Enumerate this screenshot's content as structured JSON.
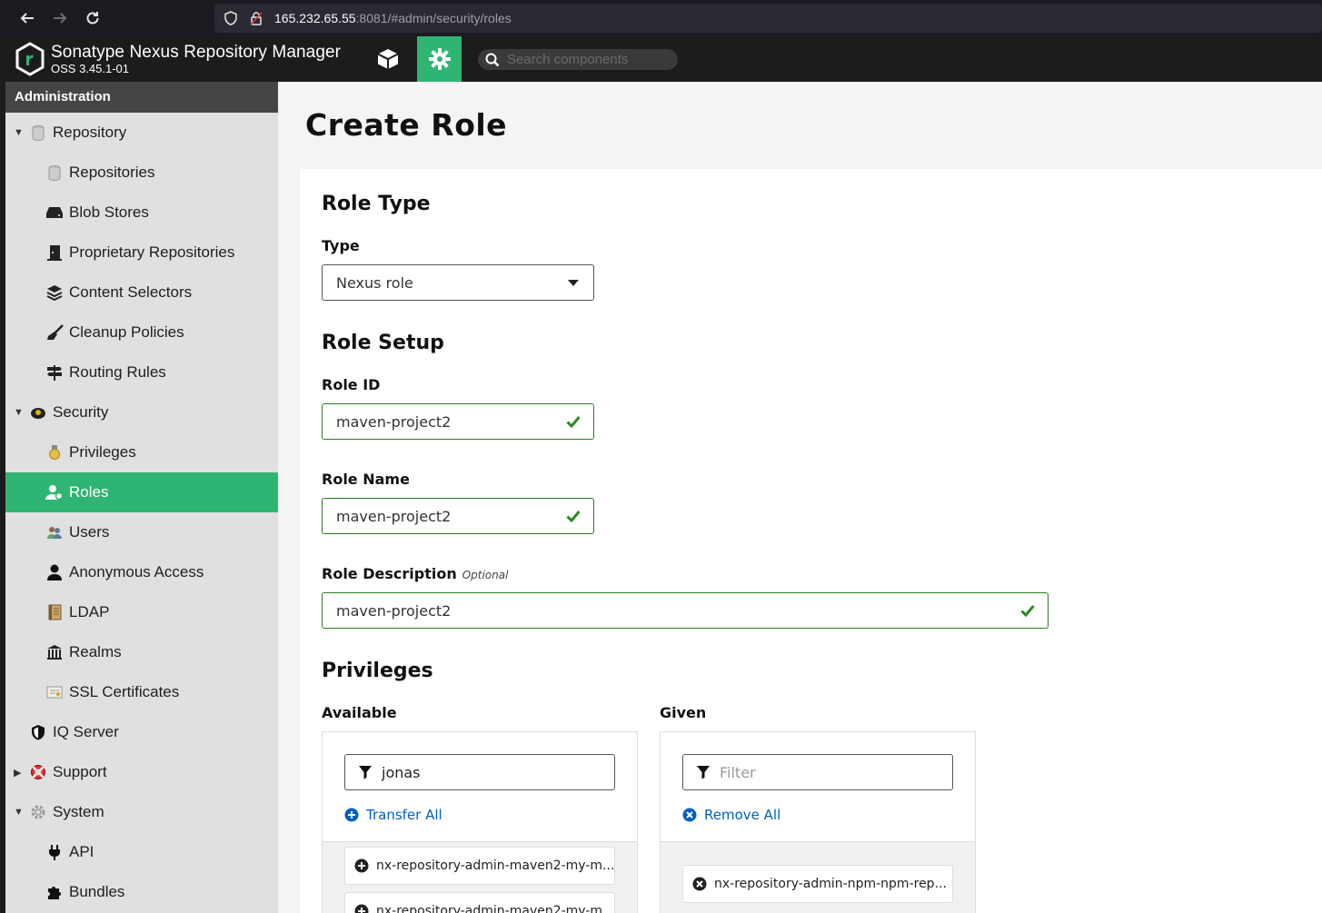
{
  "browser": {
    "url_host": "165.232.65.55",
    "url_path": ":8081/#admin/security/roles"
  },
  "header": {
    "app_title": "Sonatype Nexus Repository Manager",
    "version": "OSS 3.45.1-01",
    "search_placeholder": "Search components",
    "accent_color": "#2fb573"
  },
  "sidebar": {
    "heading": "Administration",
    "items": [
      {
        "label": "Repository",
        "icon": "database-icon",
        "level": 0,
        "expanded": true
      },
      {
        "label": "Repositories",
        "icon": "database-icon",
        "level": 1
      },
      {
        "label": "Blob Stores",
        "icon": "hard-drive-icon",
        "level": 1
      },
      {
        "label": "Proprietary Repositories",
        "icon": "door-icon",
        "level": 1
      },
      {
        "label": "Content Selectors",
        "icon": "layers-icon",
        "level": 1
      },
      {
        "label": "Cleanup Policies",
        "icon": "broom-icon",
        "level": 1
      },
      {
        "label": "Routing Rules",
        "icon": "signpost-icon",
        "level": 1
      },
      {
        "label": "Security",
        "icon": "badge-icon",
        "level": 0,
        "expanded": true
      },
      {
        "label": "Privileges",
        "icon": "medal-icon",
        "level": 1
      },
      {
        "label": "Roles",
        "icon": "user-gear-icon",
        "level": 1,
        "active": true
      },
      {
        "label": "Users",
        "icon": "users-icon",
        "level": 1
      },
      {
        "label": "Anonymous Access",
        "icon": "user-icon",
        "level": 1
      },
      {
        "label": "LDAP",
        "icon": "book-icon",
        "level": 1
      },
      {
        "label": "Realms",
        "icon": "building-icon",
        "level": 1
      },
      {
        "label": "SSL Certificates",
        "icon": "certificate-icon",
        "level": 1
      },
      {
        "label": "IQ Server",
        "icon": "shield-icon",
        "level": 0
      },
      {
        "label": "Support",
        "icon": "lifebuoy-icon",
        "level": 0,
        "expanded": false
      },
      {
        "label": "System",
        "icon": "gear-icon",
        "level": 0,
        "expanded": true
      },
      {
        "label": "API",
        "icon": "plug-icon",
        "level": 1
      },
      {
        "label": "Bundles",
        "icon": "puzzle-icon",
        "level": 1
      }
    ]
  },
  "main": {
    "title": "Create Role",
    "role_type": {
      "section_title": "Role Type",
      "type_label": "Type",
      "type_value": "Nexus role"
    },
    "role_setup": {
      "section_title": "Role Setup",
      "role_id_label": "Role ID",
      "role_id_value": "maven-project2",
      "role_name_label": "Role Name",
      "role_name_value": "maven-project2",
      "role_desc_label": "Role Description",
      "role_desc_optional": "Optional",
      "role_desc_value": "maven-project2"
    },
    "privileges": {
      "section_title": "Privileges",
      "available": {
        "label": "Available",
        "filter_value": "jonas",
        "action": "Transfer All",
        "items": [
          "nx-repository-admin-maven2-my-m...",
          "nx-repository-admin-maven2-my-m..."
        ]
      },
      "given": {
        "label": "Given",
        "filter_placeholder": "Filter",
        "action": "Remove All",
        "items": [
          "nx-repository-admin-npm-npm-rep..."
        ]
      }
    }
  }
}
